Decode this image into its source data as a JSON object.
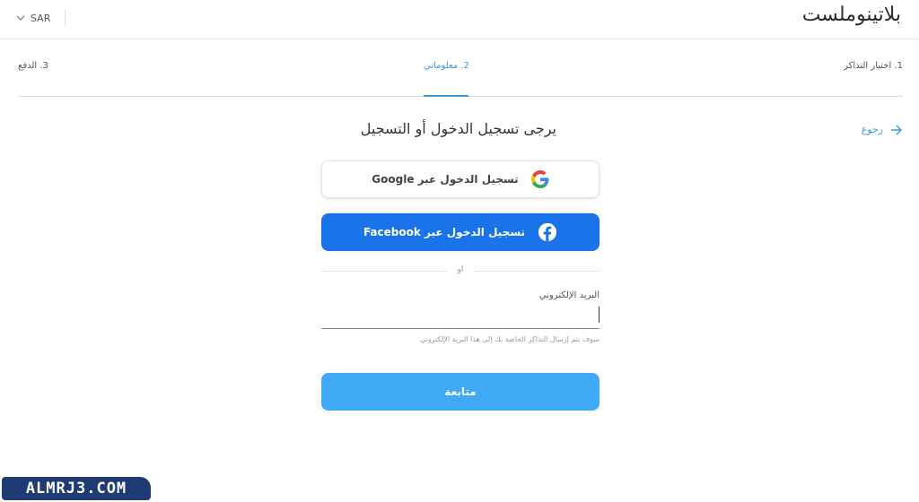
{
  "header": {
    "currency": "SAR",
    "logo": "بلاتينوملست"
  },
  "steps": [
    {
      "label": "1. اختيار التذاكر"
    },
    {
      "label": "2. معلوماتي"
    },
    {
      "label": "3. الدفع"
    }
  ],
  "main": {
    "title": "يرجى تسجيل الدخول أو التسجيل",
    "back": "رجوع",
    "google_button": "تسجيل الدخول عبر Google",
    "facebook_button": "تسجيل الدخول عبر Facebook",
    "or": "او",
    "email_label": "البريد الإلكتروني",
    "email_value": "",
    "email_helper": "سوف يتم إرسال التذاكر الخاصة بك إلى هذا البريد الإلكتروني",
    "continue_button": "متابعة"
  },
  "watermark": "ALMRJ3.COM",
  "colors": {
    "accent": "#3a9ad9",
    "facebook": "#1a73e8",
    "continue": "#3fa9f5"
  }
}
